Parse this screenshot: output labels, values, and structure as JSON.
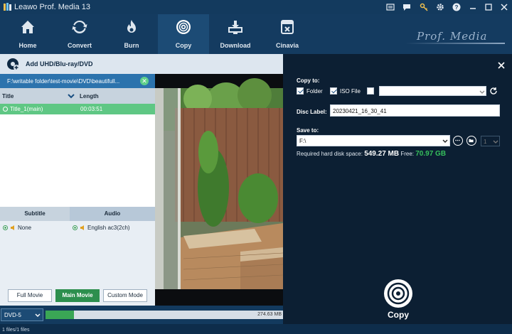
{
  "window": {
    "title": "Leawo Prof. Media 13"
  },
  "nav": {
    "items": [
      {
        "label": "Home",
        "icon": "home-icon"
      },
      {
        "label": "Convert",
        "icon": "convert-icon"
      },
      {
        "label": "Burn",
        "icon": "burn-icon"
      },
      {
        "label": "Copy",
        "icon": "copy-disc-icon",
        "active": true
      },
      {
        "label": "Download",
        "icon": "download-icon"
      },
      {
        "label": "Cinavia",
        "icon": "cinavia-icon"
      }
    ],
    "brand": "Prof. Media"
  },
  "addbar": {
    "label": "Add UHD/Blu-ray/DVD"
  },
  "source": {
    "path": "F:\\writable folder\\test-movie\\DVD\\beautifull..."
  },
  "titles": {
    "headers": {
      "title": "Title",
      "length": "Length"
    },
    "rows": [
      {
        "name": "Title_1(main)",
        "length": "00:03:51",
        "selected": true
      }
    ]
  },
  "tracks": {
    "headers": {
      "subtitle": "Subtitle",
      "audio": "Audio"
    },
    "subtitle": "None",
    "audio": "English ac3(2ch)"
  },
  "modes": {
    "full": "Full Movie",
    "main": "Main Movie",
    "custom": "Custom Mode",
    "active": "main"
  },
  "bottom": {
    "disc_type": "DVD-5",
    "size_text": "274.63 MB",
    "progress_fraction": 0.12
  },
  "status": {
    "files": "1 files/1 files"
  },
  "copy_panel": {
    "copy_to_label": "Copy to:",
    "folder_label": "Folder",
    "folder_checked": true,
    "iso_label": "ISO File",
    "iso_checked": true,
    "third_checked": false,
    "disc_label_label": "Disc Label:",
    "disc_label_value": "20230421_16_30_41",
    "save_to_label": "Save to:",
    "save_to_value": "F:\\",
    "count_value": "1",
    "required_label": "Required hard disk space:",
    "required_value": "549.27 MB",
    "free_label": "Free:",
    "free_value": "70.97 GB",
    "copy_button": "Copy"
  },
  "colors": {
    "accent_green": "#3aa655",
    "free_green": "#36c05c",
    "selected_row": "#5fc784",
    "panel_dark": "#0c1f33",
    "nav_bg": "#143b60"
  }
}
